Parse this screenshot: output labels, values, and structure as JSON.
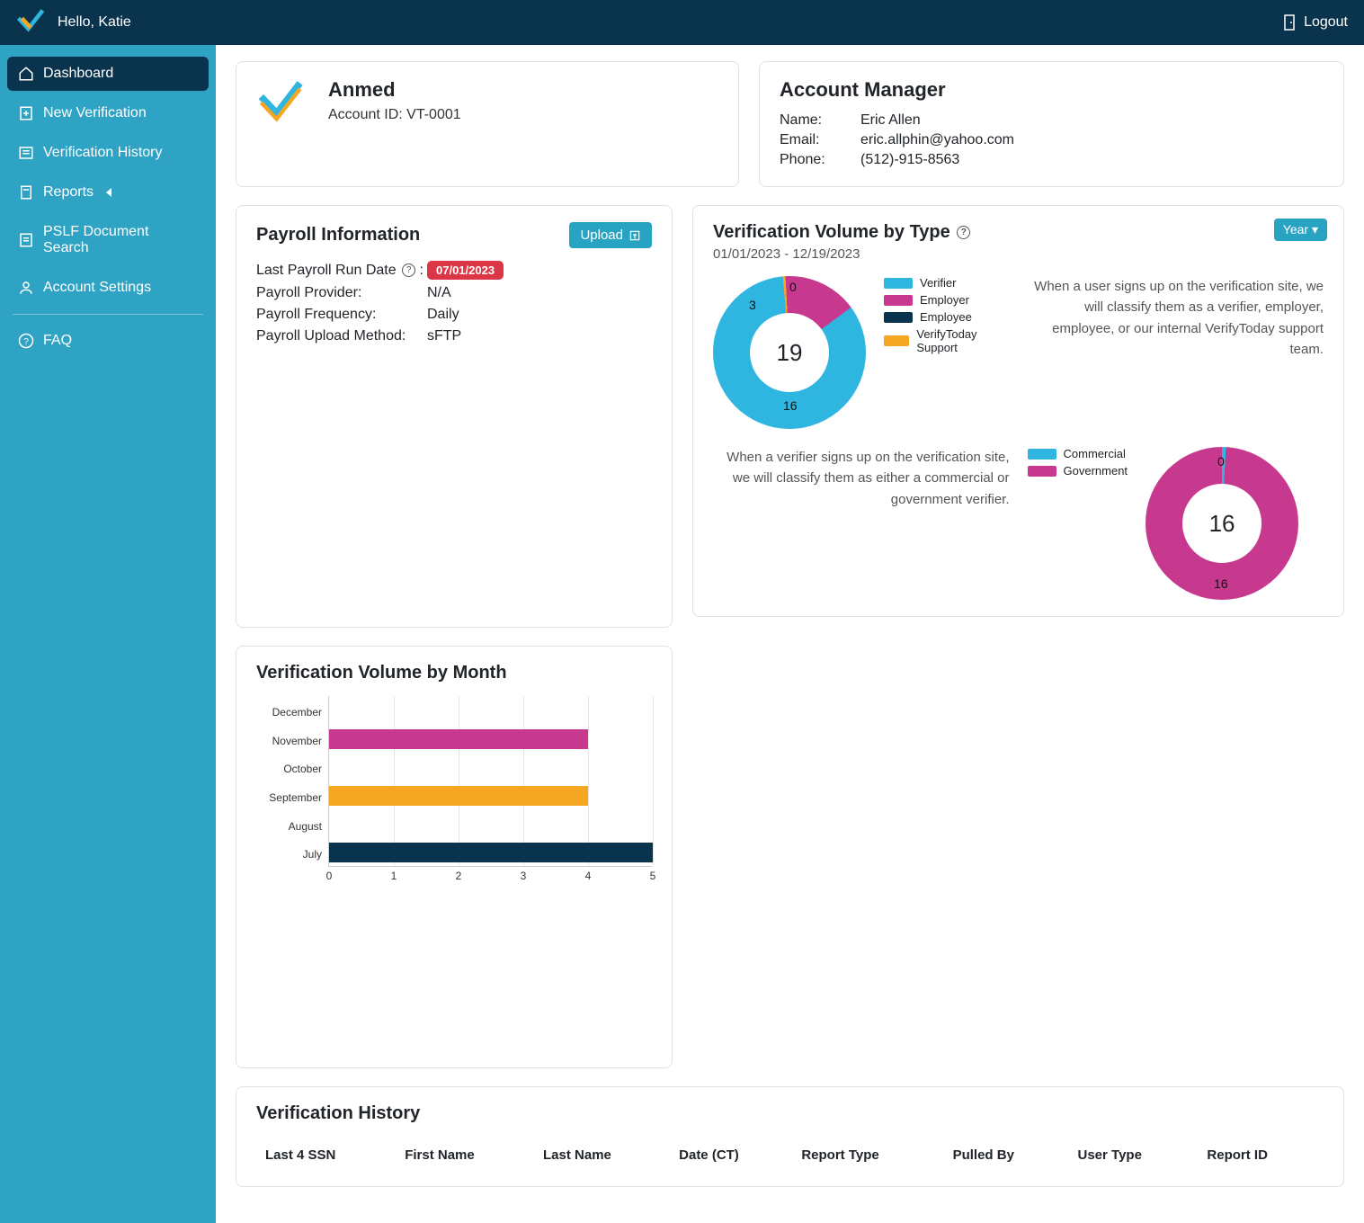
{
  "header": {
    "hello": "Hello, Katie",
    "logout": "Logout"
  },
  "sidebar": {
    "items": [
      {
        "label": "Dashboard"
      },
      {
        "label": "New Verification"
      },
      {
        "label": "Verification History"
      },
      {
        "label": "Reports"
      },
      {
        "label": "PSLF Document Search"
      },
      {
        "label": "Account Settings"
      }
    ],
    "faq": "FAQ"
  },
  "company": {
    "name": "Anmed",
    "account_id_label": "Account ID: ",
    "account_id": "VT-0001"
  },
  "manager": {
    "title": "Account Manager",
    "name_label": "Name:",
    "name": "Eric Allen",
    "email_label": "Email:",
    "email": "eric.allphin@yahoo.com",
    "phone_label": "Phone:",
    "phone": "(512)-915-8563"
  },
  "payroll": {
    "title": "Payroll Information",
    "upload": "Upload",
    "rows": {
      "last_run_label": "Last Payroll Run Date",
      "last_colon": " :",
      "last_run": "07/01/2023",
      "provider_label": "Payroll Provider:",
      "provider": "N/A",
      "freq_label": "Payroll Frequency:",
      "freq": "Daily",
      "method_label": "Payroll Upload Method:",
      "method": "sFTP"
    }
  },
  "volmonth": {
    "title": "Verification Volume by Month"
  },
  "voltype": {
    "title": "Verification Volume by Type",
    "year": "Year",
    "daterange": "01/01/2023 - 12/19/2023",
    "legend1": {
      "a": "Verifier",
      "b": "Employer",
      "c": "Employee",
      "d": "VerifyToday Support"
    },
    "explain1": "When a user signs up on the verification site, we will classify them as a verifier, employer, employee, or our internal VerifyToday support team.",
    "explain2": "When a verifier signs up on the verification site, we will classify them as either a commercial or government verifier.",
    "legend2": {
      "a": "Commercial",
      "b": "Government"
    }
  },
  "history": {
    "title": "Verification History",
    "cols": {
      "ssn": "Last 4 SSN",
      "first": "First Name",
      "last": "Last Name",
      "date": "Date (CT)",
      "rtype": "Report Type",
      "pulled": "Pulled By",
      "utype": "User Type",
      "rid": "Report ID"
    }
  },
  "colors": {
    "blue": "#2fb6e0",
    "magenta": "#c6398f",
    "navy": "#0a344d",
    "orange": "#f5a623",
    "gray": "#cccccc"
  },
  "chart_data": [
    {
      "type": "bar",
      "orientation": "horizontal",
      "title": "Verification Volume by Month",
      "categories": [
        "December",
        "November",
        "October",
        "September",
        "August",
        "July"
      ],
      "values": [
        0,
        4,
        0,
        4,
        0,
        5
      ],
      "colors": [
        "#cccccc",
        "#c6398f",
        "#cccccc",
        "#f5a623",
        "#cccccc",
        "#0a344d"
      ],
      "xlabel": "",
      "ylabel": "",
      "xlim": [
        0,
        5
      ],
      "xticks": [
        0,
        1,
        2,
        3,
        4,
        5
      ]
    },
    {
      "type": "pie",
      "title": "User Type",
      "center_total": 19,
      "series": [
        {
          "name": "Verifier",
          "value": 16,
          "color": "#2fb6e0"
        },
        {
          "name": "Employer",
          "value": 3,
          "color": "#c6398f"
        },
        {
          "name": "Employee",
          "value": 0,
          "color": "#0a344d"
        },
        {
          "name": "VerifyToday Support",
          "value": 0,
          "color": "#f5a623"
        }
      ],
      "labels_shown": {
        "verifier": "16",
        "employer": "3",
        "support": "0"
      }
    },
    {
      "type": "pie",
      "title": "Verifier Type",
      "center_total": 16,
      "series": [
        {
          "name": "Commercial",
          "value": 0,
          "color": "#2fb6e0"
        },
        {
          "name": "Government",
          "value": 16,
          "color": "#c6398f"
        }
      ],
      "labels_shown": {
        "commercial": "0",
        "government": "16"
      }
    }
  ]
}
